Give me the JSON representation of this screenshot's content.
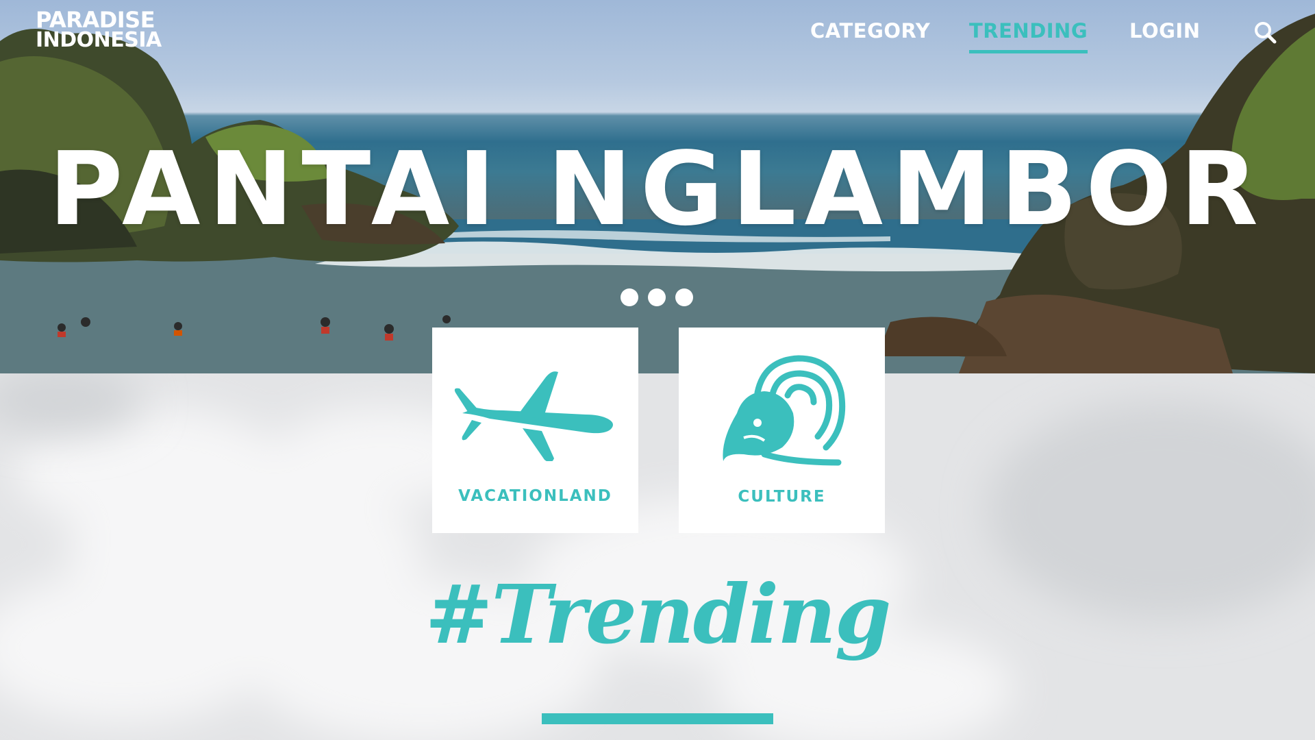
{
  "brand": {
    "line1": "PARADISE",
    "line2": "INDONESIA"
  },
  "nav": {
    "items": [
      {
        "label": "CATEGORY",
        "active": false
      },
      {
        "label": "TRENDING",
        "active": true
      },
      {
        "label": "LOGIN",
        "active": false
      }
    ],
    "search_icon": "search-icon"
  },
  "hero": {
    "title": "PANTAI NGLAMBOR",
    "slides_count": 3
  },
  "categories": [
    {
      "label": "VACATIONLAND",
      "icon": "airplane-icon"
    },
    {
      "label": "CULTURE",
      "icon": "wave-face-icon"
    }
  ],
  "trending": {
    "heading": "#Trending"
  },
  "colors": {
    "accent": "#3bbfbd",
    "card": "#ffffff",
    "text_light": "#ffffff",
    "background": "#e4e5e7"
  }
}
